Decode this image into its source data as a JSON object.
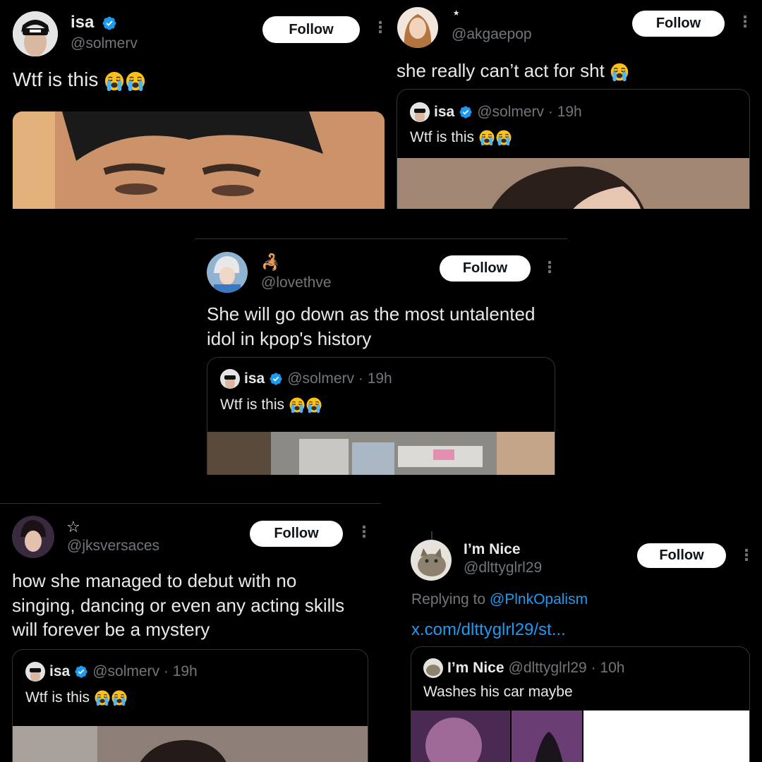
{
  "tweets": [
    {
      "name": "isa",
      "handle": "@solmerv",
      "follow_label": "Follow",
      "text": "Wtf is this"
    },
    {
      "name": "⋆",
      "handle": "@akgaepop",
      "follow_label": "Follow",
      "text": "she really can’t act for sht",
      "quote": {
        "name": "isa",
        "handle": "@solmerv",
        "time": "· 19h",
        "text": "Wtf is this"
      }
    },
    {
      "name": "🦂",
      "handle": "@lovethve",
      "follow_label": "Follow",
      "text_line1": "She will go down as the most untalented",
      "text_line2": "idol in kpop's history",
      "quote": {
        "name": "isa",
        "handle": "@solmerv",
        "time": "· 19h",
        "text": "Wtf is this"
      }
    },
    {
      "name": "☆",
      "handle": "@jksversaces",
      "follow_label": "Follow",
      "text_line1": "how she managed to debut with no",
      "text_line2": "singing, dancing or even any acting skills",
      "text_line3": "will forever be a mystery",
      "quote": {
        "name": "isa",
        "handle": "@solmerv",
        "time": "· 19h",
        "text": "Wtf is this"
      }
    },
    {
      "name": "I’m Nice",
      "handle": "@dlttyglrl29",
      "follow_label": "Follow",
      "replying_prefix": "Replying to",
      "replying_handle": "@PlnkOpalism",
      "link": "x.com/dlttyglrl29/st...",
      "quote": {
        "name": "I’m Nice",
        "handle": "@dlttyglrl29",
        "time": "· 10h",
        "text": "Washes his car maybe"
      }
    }
  ],
  "colors": {
    "background": "#000000",
    "text": "#e7e9ea",
    "muted": "#71767b",
    "link": "#1d9bf0",
    "verified": "#1d9bf0",
    "follow_bg": "#ffffff",
    "follow_text": "#0f1419"
  },
  "icons": [
    "verified-badge-icon",
    "more-options-icon",
    "loudly-crying-face-emoji"
  ]
}
